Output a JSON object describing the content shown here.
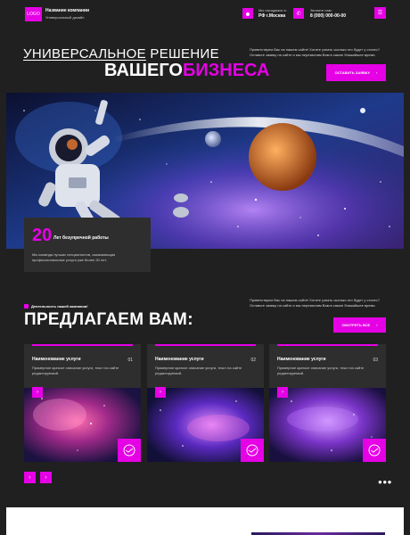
{
  "header": {
    "logo": "LOGO",
    "company_name": "Название компании",
    "company_subtitle": "Универсальный дизайн",
    "location_caption": "Мы находимся в:",
    "location_value": "РФ г.Москва",
    "phone_caption": "Звоните нам:",
    "phone_value": "8 (000) 000-00-00"
  },
  "hero": {
    "line1_underlined": "УНИВЕРСАЛЬНОЕ",
    "line1_rest": " РЕШЕНИЕ",
    "line2_white": "ВАШЕГО",
    "line2_accent": "БИЗНЕСА",
    "description": "Приветствуем Вас на нашем сайте! Хотите узнать сколько это будет у стоить? Оставьте заявку на сайте и мы перезвоним Вам в самое ближайшее время.",
    "cta_label": "ОСТАВИТЬ ЗАЯВКУ"
  },
  "experience": {
    "number": "20",
    "label": "Лет безупречной работы",
    "text": "Мы команда лучших специалистов, оказывающая профессиональные услуги уже более 20 лет."
  },
  "services": {
    "badge": "Деятельность нашей компании!",
    "title": "ПРЕДЛАГАЕМ ВАМ:",
    "description": "Приветствуем Вас на нашем сайте! Хотите узнать сколько это будет у стоить? Оставьте заявку на сайте и мы перезвоним Вам в самое ближайшее время.",
    "button_label": "СМОТРЕТЬ ВСЕ",
    "cards": [
      {
        "title": "Наименование услуги",
        "number": "01",
        "description": "Примерное краткое описание услуги, текст на сайте редактируемый."
      },
      {
        "title": "Наименование услуги",
        "number": "02",
        "description": "Примерное краткое описание услуги, текст на сайте редактируемый."
      },
      {
        "title": "Наименование услуги",
        "number": "03",
        "description": "Примерное краткое описание услуги, текст на сайте редактируемый."
      }
    ],
    "dots": "●●●"
  },
  "icons": {
    "arrow": "›",
    "prev": "‹",
    "menu": "☰",
    "pin": "⬤",
    "phone": "✆"
  },
  "colors": {
    "accent": "#e600e6",
    "background": "#202020",
    "card": "#2e2e2e"
  }
}
